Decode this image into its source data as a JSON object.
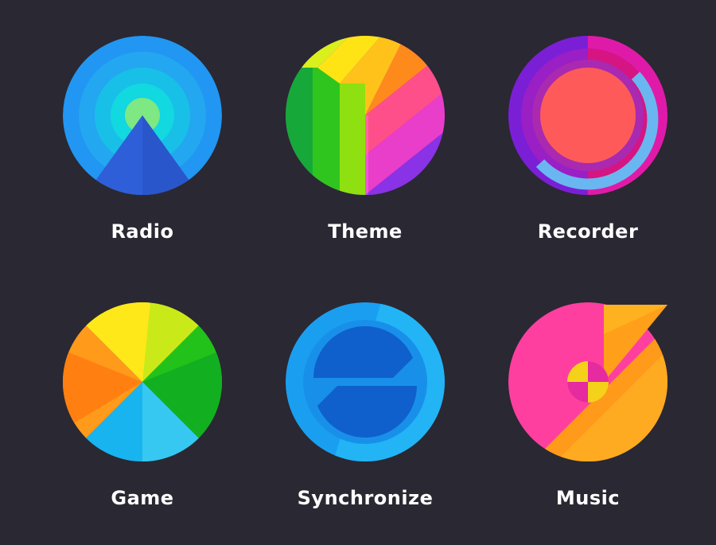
{
  "icons": [
    {
      "label": "Radio",
      "icon": "radio-icon"
    },
    {
      "label": "Theme",
      "icon": "theme-icon"
    },
    {
      "label": "Recorder",
      "icon": "recorder-icon"
    },
    {
      "label": "Game",
      "icon": "game-icon"
    },
    {
      "label": "Synchronize",
      "icon": "synchronize-icon"
    },
    {
      "label": "Music",
      "icon": "music-icon"
    }
  ],
  "colors": {
    "background": "#2a2832",
    "label_text": "#ffffff"
  }
}
